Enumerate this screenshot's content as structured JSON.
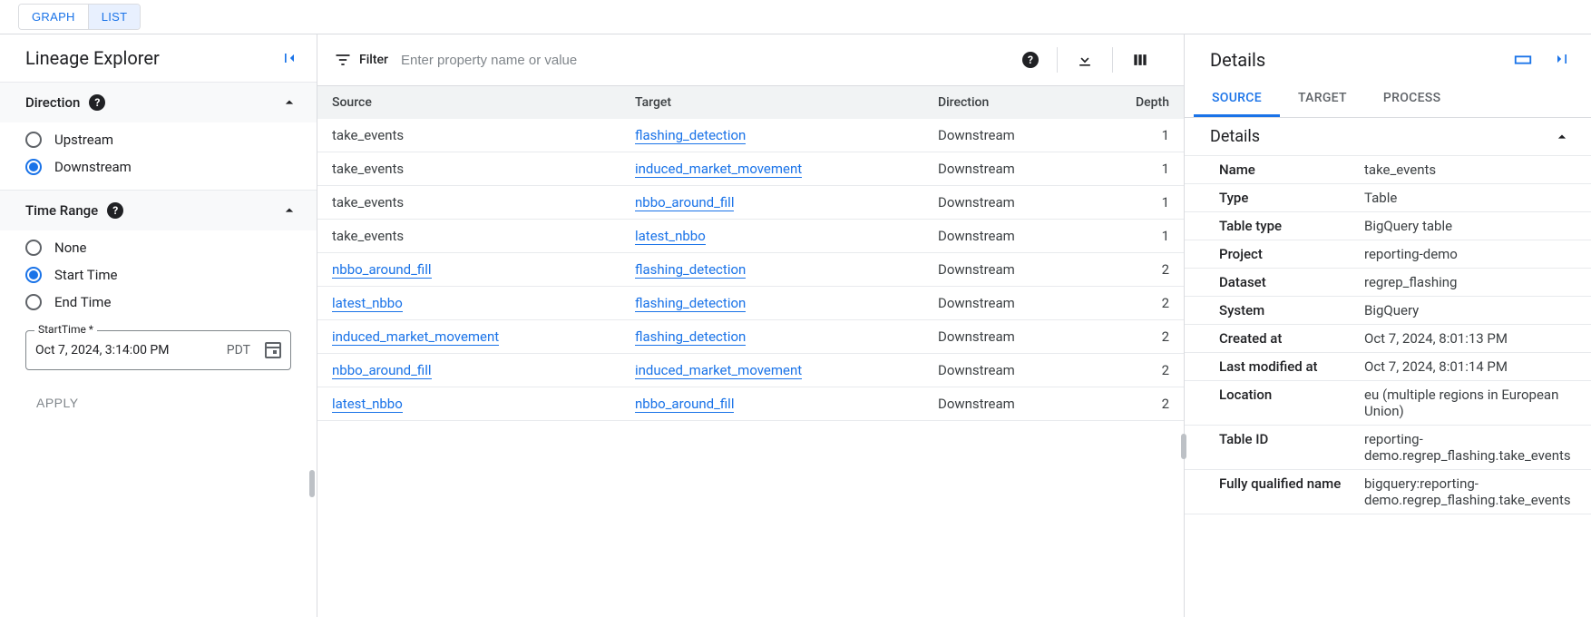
{
  "viewToggle": {
    "graph": "GRAPH",
    "list": "LIST",
    "active": "list"
  },
  "leftPanel": {
    "title": "Lineage Explorer",
    "direction": {
      "header": "Direction",
      "options": {
        "upstream": "Upstream",
        "downstream": "Downstream"
      },
      "selected": "downstream"
    },
    "timeRange": {
      "header": "Time Range",
      "options": {
        "none": "None",
        "start": "Start Time",
        "end": "End Time"
      },
      "selected": "start",
      "startLabel": "StartTime *",
      "startValue": "Oct 7, 2024, 3:14:00 PM",
      "tz": "PDT"
    },
    "apply": "APPLY"
  },
  "filter": {
    "label": "Filter",
    "placeholder": "Enter property name or value"
  },
  "table": {
    "headers": {
      "source": "Source",
      "target": "Target",
      "direction": "Direction",
      "depth": "Depth"
    },
    "rows": [
      {
        "source": "take_events",
        "sourceLink": false,
        "target": "flashing_detection",
        "direction": "Downstream",
        "depth": "1"
      },
      {
        "source": "take_events",
        "sourceLink": false,
        "target": "induced_market_movement",
        "direction": "Downstream",
        "depth": "1"
      },
      {
        "source": "take_events",
        "sourceLink": false,
        "target": "nbbo_around_fill",
        "direction": "Downstream",
        "depth": "1"
      },
      {
        "source": "take_events",
        "sourceLink": false,
        "target": "latest_nbbo",
        "direction": "Downstream",
        "depth": "1"
      },
      {
        "source": "nbbo_around_fill",
        "sourceLink": true,
        "target": "flashing_detection",
        "direction": "Downstream",
        "depth": "2"
      },
      {
        "source": "latest_nbbo",
        "sourceLink": true,
        "target": "flashing_detection",
        "direction": "Downstream",
        "depth": "2"
      },
      {
        "source": "induced_market_movement",
        "sourceLink": true,
        "target": "flashing_detection",
        "direction": "Downstream",
        "depth": "2"
      },
      {
        "source": "nbbo_around_fill",
        "sourceLink": true,
        "target": "induced_market_movement",
        "direction": "Downstream",
        "depth": "2"
      },
      {
        "source": "latest_nbbo",
        "sourceLink": true,
        "target": "nbbo_around_fill",
        "direction": "Downstream",
        "depth": "2"
      }
    ]
  },
  "details": {
    "title": "Details",
    "tabs": {
      "source": "SOURCE",
      "target": "TARGET",
      "process": "PROCESS",
      "active": "source"
    },
    "sectionTitle": "Details",
    "kv": [
      {
        "k": "Name",
        "v": "take_events"
      },
      {
        "k": "Type",
        "v": "Table"
      },
      {
        "k": "Table type",
        "v": "BigQuery table"
      },
      {
        "k": "Project",
        "v": "reporting-demo"
      },
      {
        "k": "Dataset",
        "v": "regrep_flashing"
      },
      {
        "k": "System",
        "v": "BigQuery"
      },
      {
        "k": "Created at",
        "v": "Oct 7, 2024, 8:01:13 PM"
      },
      {
        "k": "Last modified at",
        "v": "Oct 7, 2024, 8:01:14 PM"
      },
      {
        "k": "Location",
        "v": "eu (multiple regions in European Union)"
      },
      {
        "k": "Table ID",
        "v": "reporting-demo.regrep_flashing.take_events"
      },
      {
        "k": "Fully qualified name",
        "v": "bigquery:reporting-demo.regrep_flashing.take_events"
      }
    ]
  }
}
